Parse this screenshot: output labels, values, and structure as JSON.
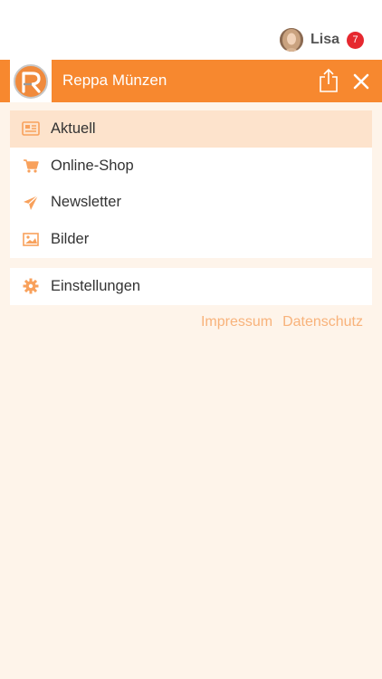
{
  "user": {
    "name": "Lisa",
    "notifications": "7"
  },
  "header": {
    "title": "Reppa Münzen",
    "logo_icon": "reppa-logo-icon",
    "share_icon": "share-icon",
    "close_icon": "close-icon"
  },
  "menu": {
    "items": [
      {
        "label": "Aktuell",
        "icon": "newspaper-icon",
        "active": true
      },
      {
        "label": "Online-Shop",
        "icon": "cart-icon",
        "active": false
      },
      {
        "label": "Newsletter",
        "icon": "paper-plane-icon",
        "active": false
      },
      {
        "label": "Bilder",
        "icon": "image-icon",
        "active": false
      }
    ],
    "settings": {
      "label": "Einstellungen",
      "icon": "gear-icon"
    }
  },
  "footer_links": {
    "impressum": "Impressum",
    "datenschutz": "Datenschutz"
  },
  "colors": {
    "accent": "#f7882f",
    "background": "#fef4ea",
    "active_item": "#fde3cc",
    "link": "#f8b27a",
    "badge": "#e6282f"
  }
}
